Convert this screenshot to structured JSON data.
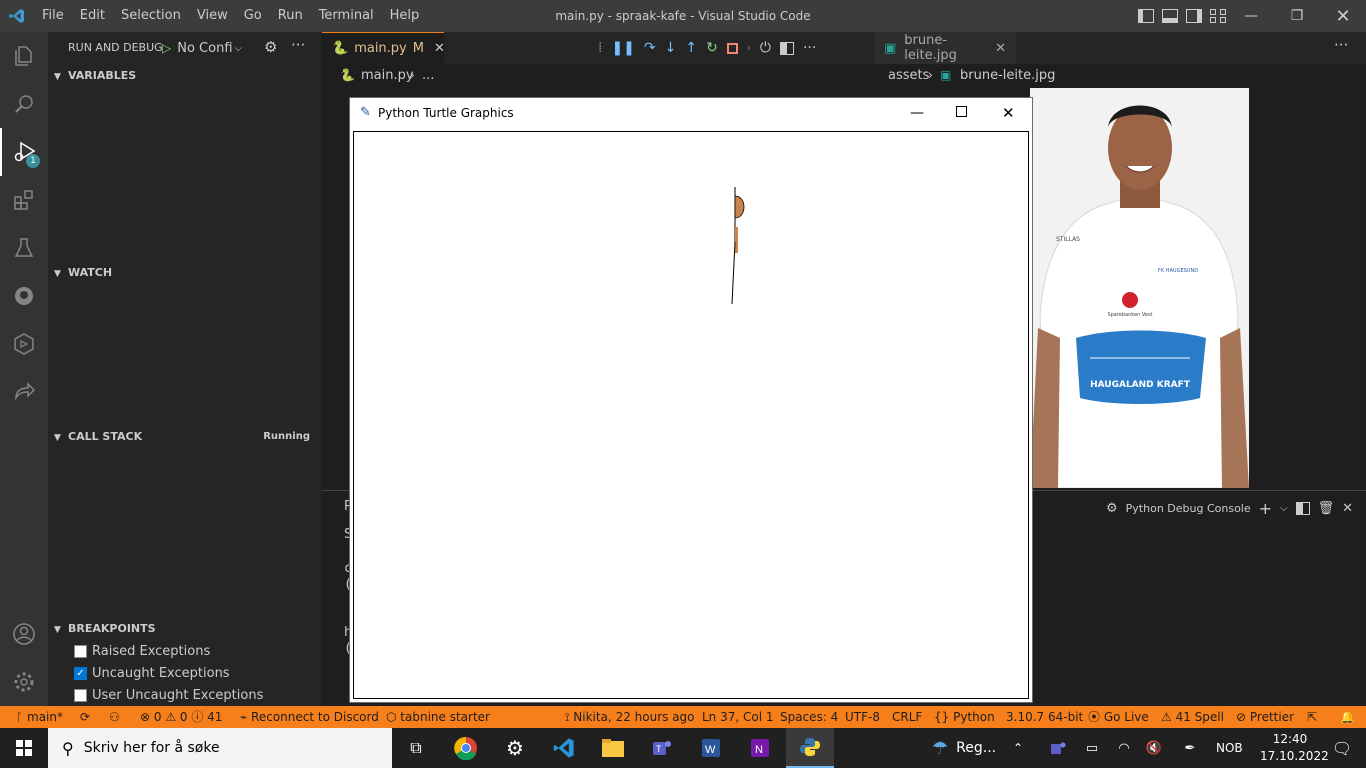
{
  "titlebar": {
    "menu": [
      "File",
      "Edit",
      "Selection",
      "View",
      "Go",
      "Run",
      "Terminal",
      "Help"
    ],
    "title": "main.py - spraak-kafe - Visual Studio Code"
  },
  "activity": {
    "debug_badge": "1"
  },
  "sidebar": {
    "header": "RUN AND DEBUG",
    "config_label": "No Confi",
    "sections": {
      "variables": "VARIABLES",
      "watch": "WATCH",
      "callstack": "CALL STACK",
      "callstack_status": "Running",
      "breakpoints": "BREAKPOINTS"
    },
    "breakpoints": [
      {
        "label": "Raised Exceptions",
        "checked": false
      },
      {
        "label": "Uncaught Exceptions",
        "checked": true
      },
      {
        "label": "User Uncaught Exceptions",
        "checked": false
      }
    ]
  },
  "editor_left": {
    "tab_label": "main.py",
    "tab_modified": "M",
    "breadcrumb_file": "main.py",
    "breadcrumb_more": "..."
  },
  "editor_right": {
    "tab_label": "brune-leite.jpg",
    "breadcrumb_folder": "assets",
    "breadcrumb_file": "brune-leite.jpg"
  },
  "panel": {
    "console_label": "Python Debug Console",
    "partial_lines": [
      "P",
      "S",
      "c",
      "(",
      "h",
      "("
    ]
  },
  "turtle_window": {
    "title": "Python Turtle Graphics"
  },
  "jersey": {
    "sponsor_text": "HAUGALAND KRAFT",
    "bank_text": "Sparebanken Vest",
    "sleeve_text": "STILLAS",
    "club_text": "FK HAUGESUND"
  },
  "statusbar": {
    "branch": "main*",
    "problems": "⊗ 0 ⚠ 0 ⓘ 41",
    "discord": "Reconnect to Discord",
    "tabnine": "tabnine starter",
    "git_author": "Nikita, 22 hours ago",
    "position": "Ln 37, Col 1",
    "spaces": "Spaces: 4",
    "encoding": "UTF-8",
    "eol": "CRLF",
    "language": "Python",
    "interpreter": "3.10.7 64-bit",
    "golive": "Go Live",
    "spell": "41 Spell",
    "prettier": "Prettier"
  },
  "taskbar": {
    "search_placeholder": "Skriv her for å søke",
    "weather": "Reg...",
    "lang": "NOB",
    "time": "12:40",
    "date": "17.10.2022"
  }
}
